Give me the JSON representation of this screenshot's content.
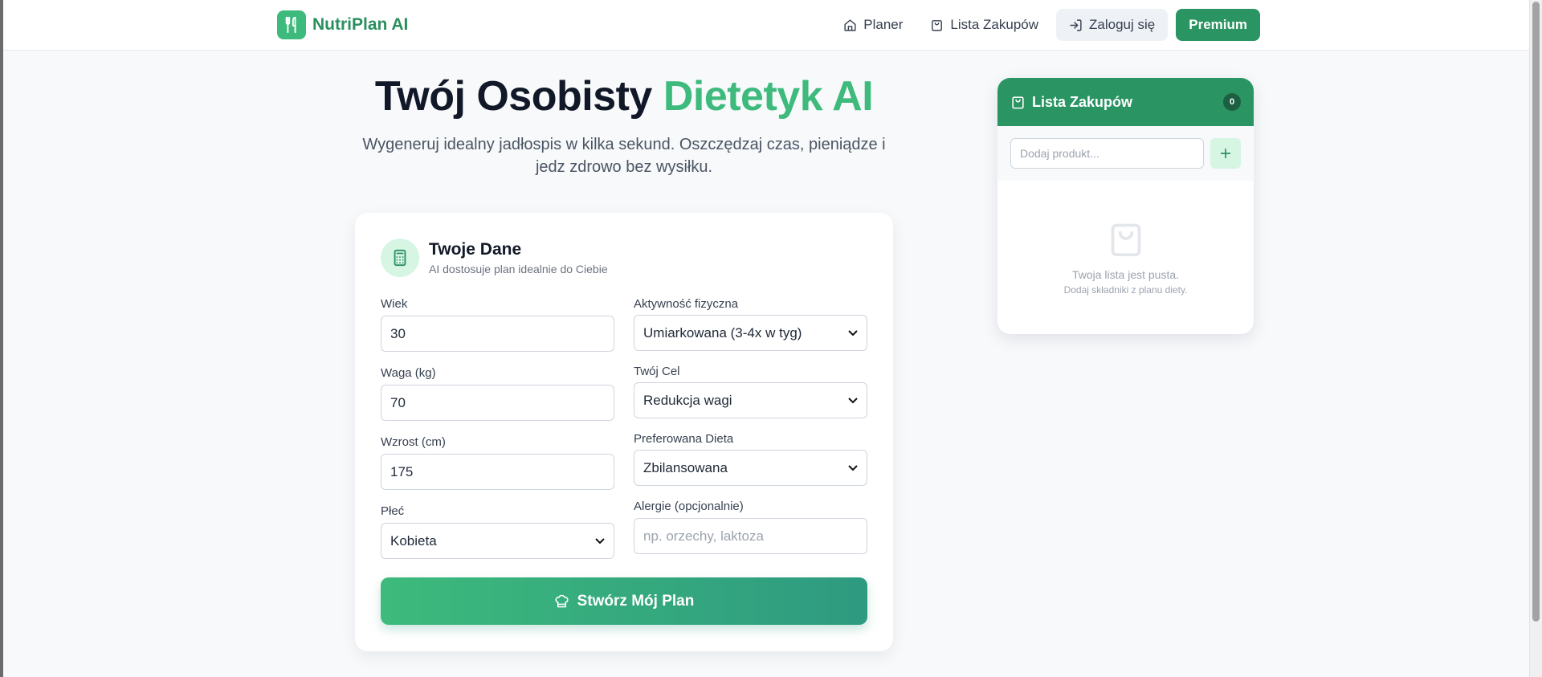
{
  "brand": {
    "name": "NutriPlan AI"
  },
  "nav": {
    "planner": "Planer",
    "shopping_list": "Lista Zakupów",
    "login": "Zaloguj się",
    "premium": "Premium"
  },
  "hero": {
    "title_main": "Twój Osobisty ",
    "title_accent": "Dietetyk AI",
    "subtitle": "Wygeneruj idealny jadłospis w kilka sekund. Oszczędzaj czas, pieniądze i jedz zdrowo bez wysiłku."
  },
  "form": {
    "title": "Twoje Dane",
    "subtitle": "AI dostosuje plan idealnie do Ciebie",
    "age": {
      "label": "Wiek",
      "value": "30"
    },
    "weight": {
      "label": "Waga (kg)",
      "value": "70"
    },
    "height": {
      "label": "Wzrost (cm)",
      "value": "175"
    },
    "sex": {
      "label": "Płeć",
      "value": "Kobieta"
    },
    "activity": {
      "label": "Aktywność fizyczna",
      "value": "Umiarkowana (3-4x w tyg)"
    },
    "goal": {
      "label": "Twój Cel",
      "value": "Redukcja wagi"
    },
    "diet": {
      "label": "Preferowana Dieta",
      "value": "Zbilansowana"
    },
    "allergies": {
      "label": "Alergie (opcjonalnie)",
      "placeholder": "np. orzechy, laktoza"
    },
    "submit": "Stwórz Mój Plan"
  },
  "shopping": {
    "title": "Lista Zakupów",
    "count": "0",
    "input_placeholder": "Dodaj produkt...",
    "empty_title": "Twoja lista jest pusta.",
    "empty_sub": "Dodaj składniki z planu diety."
  },
  "colors": {
    "brand": "#2a8f5f",
    "accent": "#3dba7c",
    "primary": "#2a9463"
  }
}
